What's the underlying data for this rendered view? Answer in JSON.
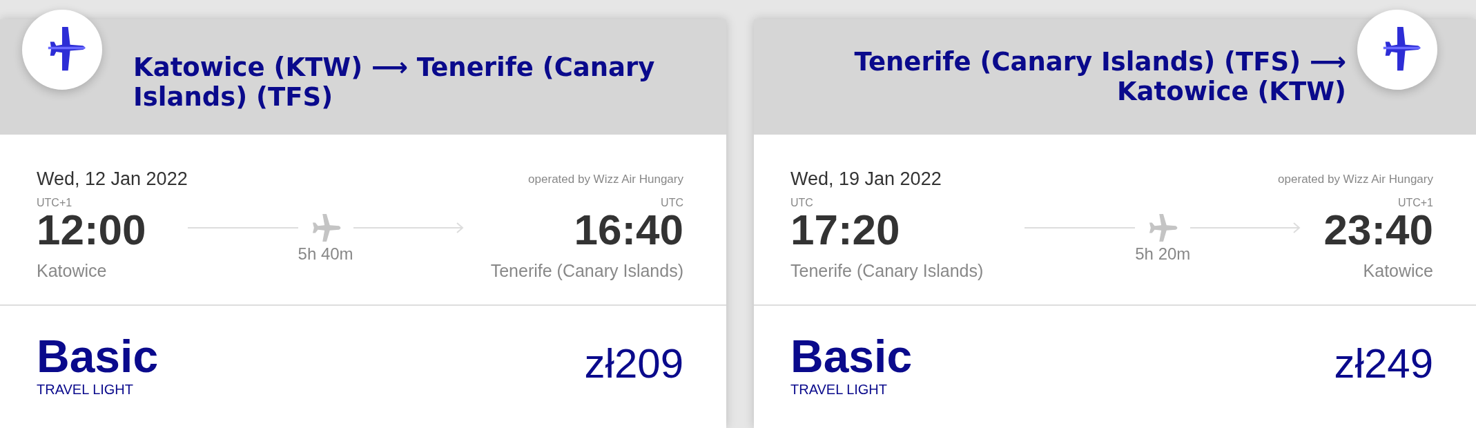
{
  "flights": [
    {
      "kind": "outbound",
      "route": "Katowice (KTW) ⟶ Tenerife (Canary Islands) (TFS)",
      "date": "Wed, 12 Jan 2022",
      "operator": "operated by Wizz Air Hungary",
      "departure": {
        "zone": "UTC+1",
        "time": "12:00",
        "city": "Katowice"
      },
      "duration": "5h 40m",
      "arrival": {
        "zone": "UTC",
        "time": "16:40",
        "city": "Tenerife (Canary Islands)"
      },
      "fare": {
        "name": "Basic",
        "tagline": "TRAVEL LIGHT",
        "price": "zł209"
      }
    },
    {
      "kind": "return",
      "route": "Tenerife (Canary Islands) (TFS) ⟶ Katowice (KTW)",
      "date": "Wed, 19 Jan 2022",
      "operator": "operated by Wizz Air Hungary",
      "departure": {
        "zone": "UTC",
        "time": "17:20",
        "city": "Tenerife (Canary Islands)"
      },
      "duration": "5h 20m",
      "arrival": {
        "zone": "UTC+1",
        "time": "23:40",
        "city": "Katowice"
      },
      "fare": {
        "name": "Basic",
        "tagline": "TRAVEL LIGHT",
        "price": "zł249"
      }
    }
  ]
}
